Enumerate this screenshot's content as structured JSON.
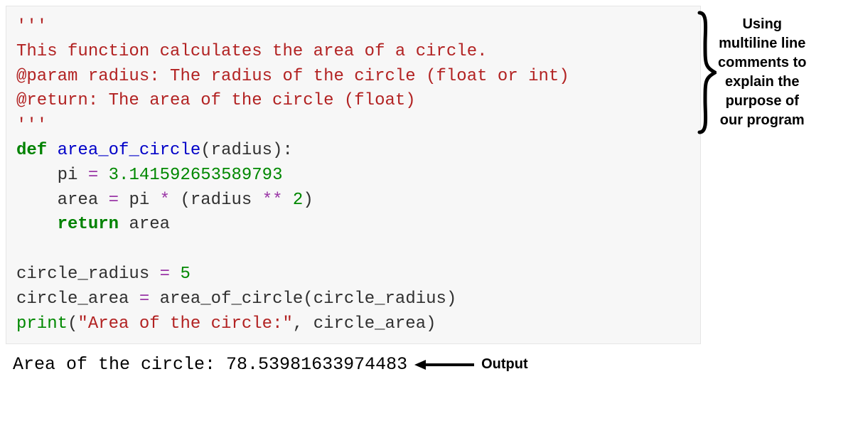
{
  "code": {
    "doc_open": "'''",
    "doc_line1": "This function calculates the area of a circle.",
    "doc_line2": "@param radius: The radius of the circle (float or int)",
    "doc_line3": "@return: The area of the circle (float)",
    "doc_close": "'''",
    "def_kw": "def",
    "func_name": "area_of_circle",
    "open_paren": "(",
    "param": "radius",
    "close_paren_colon": "):",
    "indent": "    ",
    "pi_ident": "pi",
    "eq": " = ",
    "pi_value": "3.141592653589793",
    "area_ident": "area",
    "pi_ref": "pi",
    "star": " * ",
    "lpar": "(",
    "radius_ref": "radius",
    "dstar": " ** ",
    "two": "2",
    "rpar": ")",
    "return_kw": "return",
    "space": " ",
    "area_ref": "area",
    "cr_ident": "circle_radius",
    "five": "5",
    "ca_ident": "circle_area",
    "func_ref": "area_of_circle",
    "cr_ref": "circle_radius",
    "print_kw": "print",
    "str_literal": "\"Area of the circle:\"",
    "comma_sp": ", ",
    "ca_ref": "circle_area"
  },
  "annotation": {
    "l1": "Using",
    "l2": "multiline line",
    "l3": "comments to",
    "l4": "explain the",
    "l5": "purpose of",
    "l6": "our program"
  },
  "output": {
    "text": "Area of the circle: 78.53981633974483",
    "label": "Output"
  }
}
